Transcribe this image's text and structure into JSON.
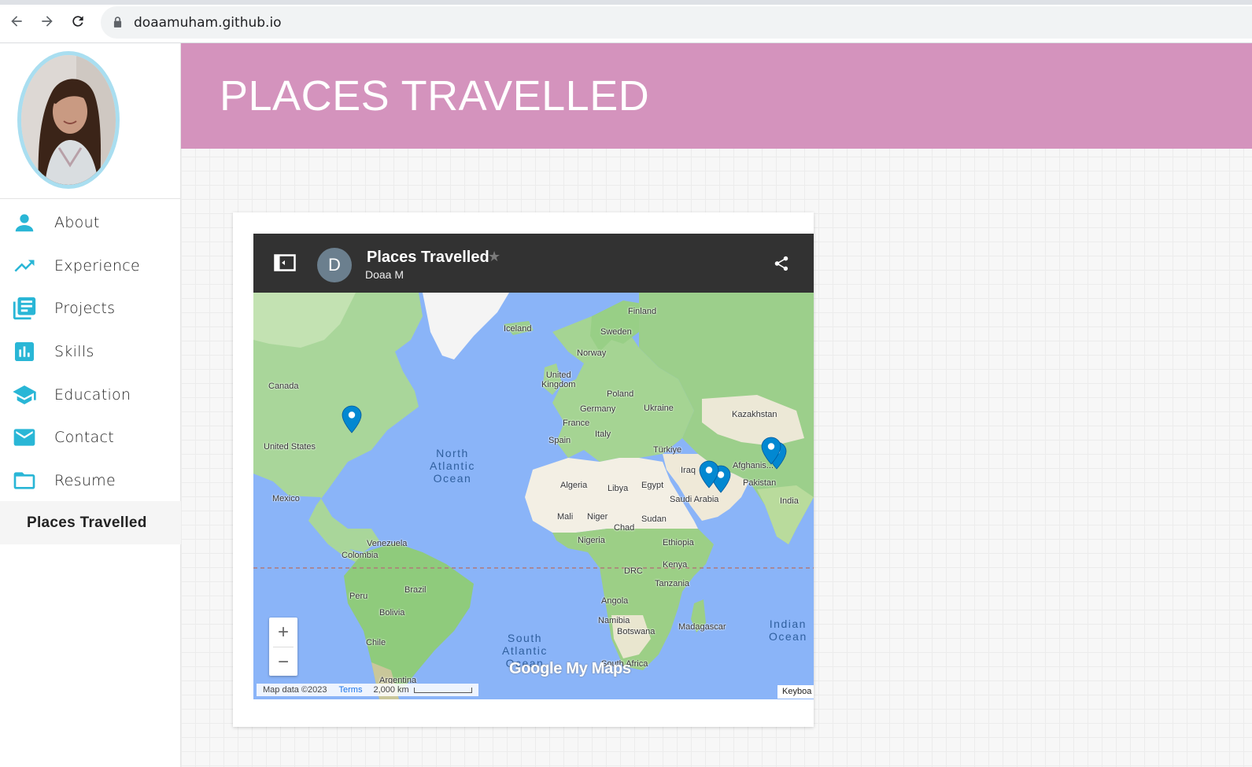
{
  "browser": {
    "url": "doaamuham.github.io",
    "icons": [
      "back-arrow-icon",
      "forward-arrow-icon",
      "reload-icon",
      "lock-icon"
    ]
  },
  "sidebar": {
    "items": [
      {
        "label": "About",
        "icon": "person-icon"
      },
      {
        "label": "Experience",
        "icon": "trending-up-icon"
      },
      {
        "label": "Projects",
        "icon": "library-books-icon"
      },
      {
        "label": "Skills",
        "icon": "bar-chart-icon"
      },
      {
        "label": "Education",
        "icon": "school-icon"
      },
      {
        "label": "Contact",
        "icon": "mail-icon"
      },
      {
        "label": "Resume",
        "icon": "folder-icon"
      },
      {
        "label": "Places Travelled",
        "icon": ""
      }
    ],
    "active_item": "Places Travelled",
    "accent_color": "#29b6d6"
  },
  "banner": {
    "title": "PLACES TRAVELLED",
    "color": "#d493bd"
  },
  "map": {
    "title": "Places Travelled",
    "owner": "Doaa M",
    "owner_initial": "D",
    "labels": {
      "iceland": "Iceland",
      "finland": "Finland",
      "sweden": "Sweden",
      "norway": "Norway",
      "uk": "United\nKingdom",
      "poland": "Poland",
      "germany": "Germany",
      "ukraine": "Ukraine",
      "kazakhstan": "Kazakhstan",
      "france": "France",
      "italy": "Italy",
      "spain": "Spain",
      "turkiye": "Türkiye",
      "canada": "Canada",
      "us": "United States",
      "mexico": "Mexico",
      "iraq": "Iraq",
      "afghanistan": "Afghanis...",
      "pakistan": "Pakistan",
      "algeria": "Algeria",
      "libya": "Libya",
      "egypt": "Egypt",
      "saudi": "Saudi Arabia",
      "india": "India",
      "mali": "Mali",
      "niger": "Niger",
      "sudan": "Sudan",
      "chad": "Chad",
      "nigeria": "Nigeria",
      "ethiopia": "Ethiopia",
      "venezuela": "Venezuela",
      "colombia": "Colombia",
      "kenya": "Kenya",
      "drc": "DRC",
      "tanzania": "Tanzania",
      "brazil": "Brazil",
      "peru": "Peru",
      "bolivia": "Bolivia",
      "angola": "Angola",
      "namibia": "Namibia",
      "botswana": "Botswana",
      "madagascar": "Madagascar",
      "chile": "Chile",
      "south_africa": "South Africa",
      "argentina": "Argentina"
    },
    "oceans": {
      "north_atlantic": "North\nAtlantic\nOcean",
      "south_atlantic": "South\nAtlantic\nOcean",
      "indian": "Indian\nOcean"
    },
    "zoom_in": "+",
    "zoom_out": "−",
    "logo": "Google My Maps",
    "attribution": "Map data ©2023",
    "terms": "Terms",
    "scale": "2,000 km",
    "keyboard": "Keyboa",
    "pin_color": "#0288d1",
    "pin_count": 5
  }
}
